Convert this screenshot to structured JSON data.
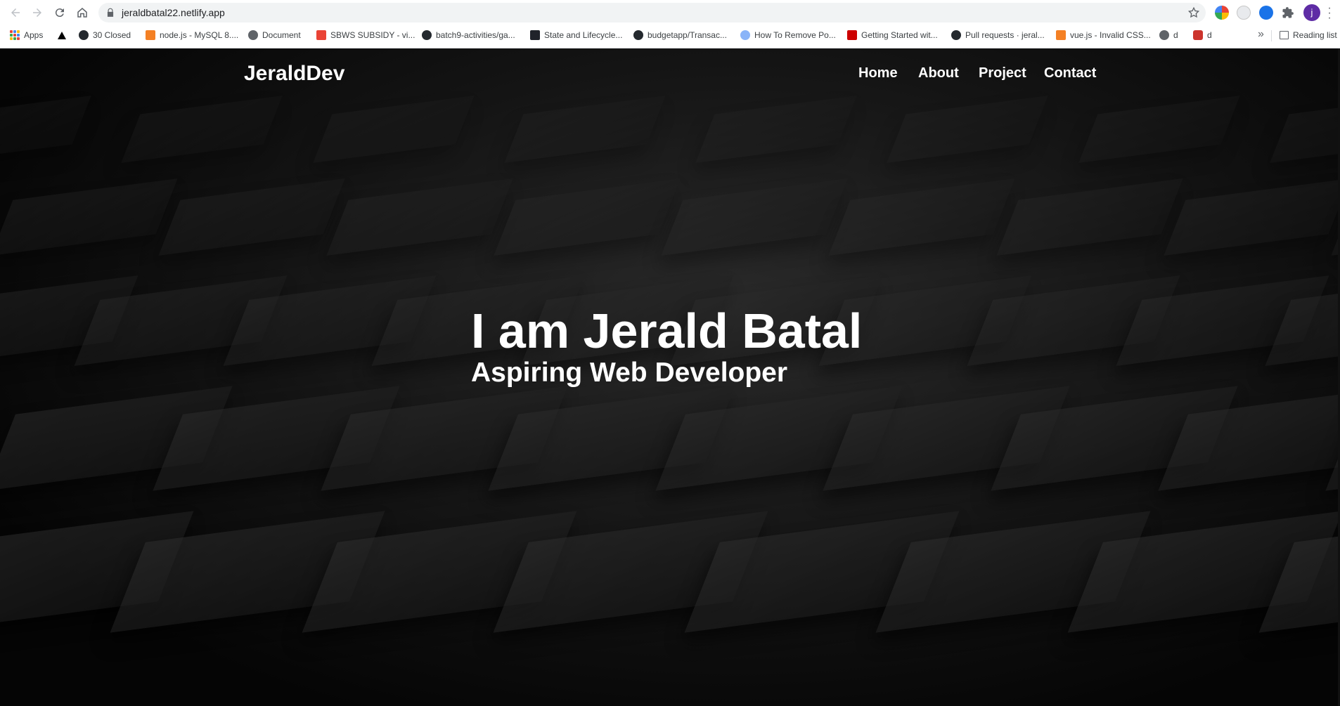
{
  "browser": {
    "url": "jeraldbatal22.netlify.app",
    "avatar_letter": "j",
    "bookmarks": [
      {
        "label": "Apps",
        "icon": "apps-grid-icon"
      },
      {
        "label": "",
        "icon": "drive-icon"
      },
      {
        "label": "30 Closed",
        "icon": "github-icon"
      },
      {
        "label": "node.js - MySQL 8....",
        "icon": "stackoverflow-icon"
      },
      {
        "label": "Document",
        "icon": "globe-icon"
      },
      {
        "label": "SBWS SUBSIDY - vi...",
        "icon": "gmail-icon"
      },
      {
        "label": "batch9-activities/ga...",
        "icon": "github-icon"
      },
      {
        "label": "State and Lifecycle...",
        "icon": "react-icon"
      },
      {
        "label": "budgetapp/Transac...",
        "icon": "github-icon"
      },
      {
        "label": "How To Remove Po...",
        "icon": "cloud-icon"
      },
      {
        "label": "Getting Started wit...",
        "icon": "ruby-gem-icon"
      },
      {
        "label": "Pull requests · jeral...",
        "icon": "github-icon"
      },
      {
        "label": "vue.js - Invalid CSS...",
        "icon": "stackoverflow-icon"
      },
      {
        "label": "d",
        "icon": "globe-icon"
      },
      {
        "label": "d",
        "icon": "ruby-icon"
      }
    ],
    "overflow": "»",
    "reading_list": "Reading list"
  },
  "site": {
    "brand": "JeraldDev",
    "nav": [
      "Home",
      "About",
      "Project",
      "Contact"
    ],
    "hero_title": "I am Jerald Batal",
    "hero_subtitle": "Aspiring Web Developer"
  },
  "colors": {
    "page_bg": "#000000",
    "text": "#ffffff",
    "chrome_bg": "#ffffff",
    "omnibox_bg": "#f1f3f4",
    "avatar_bg": "#5e2ca5"
  }
}
